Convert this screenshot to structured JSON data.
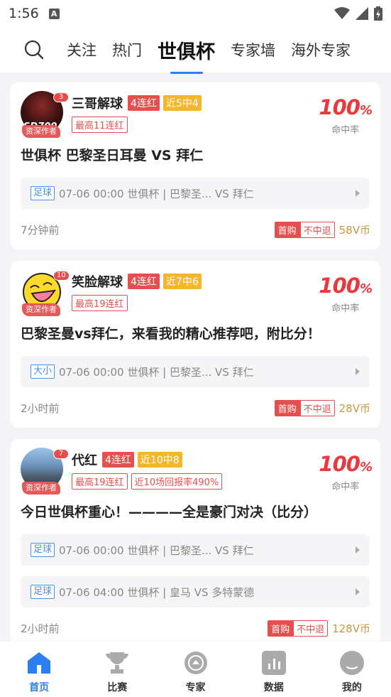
{
  "status_bar": {
    "time": "1:56",
    "notif_glyph": "A"
  },
  "top_nav": {
    "tabs": [
      {
        "label": "关注"
      },
      {
        "label": "热门"
      },
      {
        "label": "世俱杯"
      },
      {
        "label": "专家墙"
      },
      {
        "label": "海外专家"
      }
    ],
    "active_tab": "世俱杯"
  },
  "cards": [
    {
      "author": "三哥解球",
      "badge_count": "3",
      "senior_label": "资深作者",
      "avatar_text": "SD700",
      "streak": "4连红",
      "recent": "近5中4",
      "highlights": [
        "最高11连红"
      ],
      "hit_rate": "100",
      "hit_rate_unit": "%",
      "hit_rate_label": "命中率",
      "title": "世俱杯 巴黎圣日耳曼 VS 拜仁",
      "matches": [
        {
          "type": "足球",
          "text": "07-06 00:00 世俱杯 | 巴黎圣... VS 拜仁"
        }
      ],
      "time_ago": "7分钟前",
      "first_buy": "首购",
      "no_refund": "不中退",
      "price": "58V币"
    },
    {
      "author": "笑脸解球",
      "badge_count": "10",
      "senior_label": "资深作者",
      "streak": "4连红",
      "recent": "近7中6",
      "highlights": [
        "最高19连红"
      ],
      "hit_rate": "100",
      "hit_rate_unit": "%",
      "hit_rate_label": "命中率",
      "title": "巴黎圣曼vs拜仁，来看我的精心推荐吧，附比分！",
      "matches": [
        {
          "type": "大小",
          "text": "07-06 00:00 世俱杯 | 巴黎圣... VS 拜仁"
        }
      ],
      "time_ago": "2小时前",
      "first_buy": "首购",
      "no_refund": "不中退",
      "price": "28V币"
    },
    {
      "author": "代红",
      "badge_count": "7",
      "senior_label": "资深作者",
      "streak": "4连红",
      "recent": "近10中8",
      "highlights": [
        "最高19连红",
        "近10场回报率490%"
      ],
      "hit_rate": "100",
      "hit_rate_unit": "%",
      "hit_rate_label": "命中率",
      "title": "今日世俱杯重心！————全是豪门对决（比分）",
      "matches": [
        {
          "type": "足球",
          "text": "07-06 00:00 世俱杯 | 巴黎圣... VS 拜仁"
        },
        {
          "type": "足球",
          "text": "07-06 04:00 世俱杯 | 皇马 VS 多特蒙德"
        }
      ],
      "time_ago": "2小时前",
      "first_buy": "首购",
      "no_refund": "不中退",
      "price": "128V币"
    }
  ],
  "bottom_nav": {
    "items": [
      {
        "label": "首页",
        "icon": "home-icon"
      },
      {
        "label": "比赛",
        "icon": "trophy-icon"
      },
      {
        "label": "专家",
        "icon": "expert-icon"
      },
      {
        "label": "数据",
        "icon": "chart-icon"
      },
      {
        "label": "我的",
        "icon": "profile-icon"
      }
    ],
    "active": "首页"
  },
  "colors": {
    "accent": "#2d7ef0",
    "red": "#e5504e",
    "orange": "#f5b62b",
    "gold": "#c9973c"
  }
}
